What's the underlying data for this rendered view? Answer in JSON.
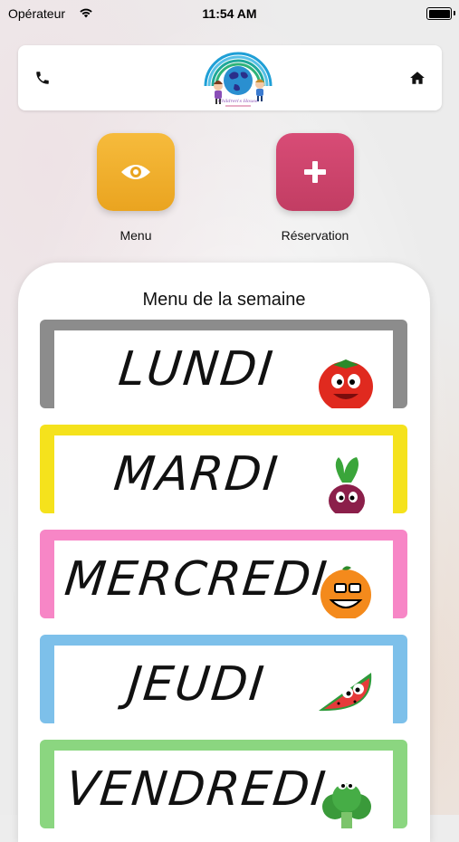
{
  "status_bar": {
    "carrier": "Opérateur",
    "time": "11:54 AM"
  },
  "header": {
    "logo_text": "Children's House",
    "phone_icon": "phone-icon",
    "home_icon": "home-icon"
  },
  "actions": [
    {
      "label": "Menu",
      "icon": "eye-icon",
      "color": "#f2b431"
    },
    {
      "label": "Réservation",
      "icon": "plus-icon",
      "color": "#cf456d"
    }
  ],
  "menu": {
    "title": "Menu de la semaine",
    "days": [
      {
        "name": "LUNDI",
        "border_color": "#8c8c8c",
        "mascot": "tomato-icon"
      },
      {
        "name": "MARDI",
        "border_color": "#f5e21c",
        "mascot": "beet-icon"
      },
      {
        "name": "MERCREDI",
        "border_color": "#f786c6",
        "mascot": "orange-icon"
      },
      {
        "name": "JEUDI",
        "border_color": "#7dc0ea",
        "mascot": "watermelon-icon"
      },
      {
        "name": "VENDREDI",
        "border_color": "#8bd680",
        "mascot": "broccoli-icon"
      }
    ]
  }
}
